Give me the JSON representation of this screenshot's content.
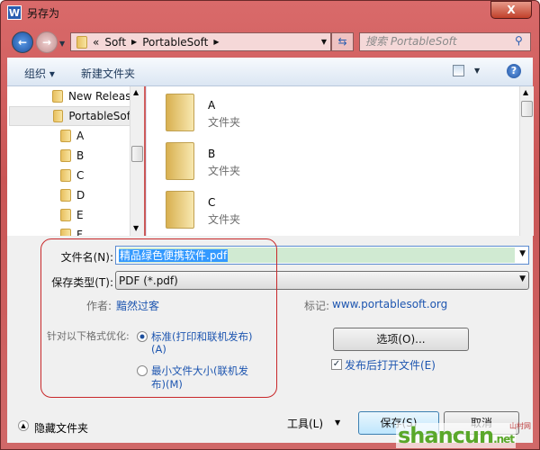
{
  "window": {
    "title": "另存为",
    "app_icon": "W",
    "close": "X"
  },
  "nav": {
    "back": "back-arrow-icon",
    "forward": "forward-arrow-icon",
    "breadcrumb": [
      "«",
      "Soft",
      "PortableSoft"
    ],
    "search_placeholder": "搜索 PortableSoft"
  },
  "toolbar": {
    "organize": "组织 ▾",
    "new_folder": "新建文件夹",
    "help": "?"
  },
  "tree": [
    "New Releas",
    "PortableSof",
    "A",
    "B",
    "C",
    "D",
    "E",
    "F"
  ],
  "files": [
    {
      "name": "A",
      "type": "文件夹"
    },
    {
      "name": "B",
      "type": "文件夹"
    },
    {
      "name": "C",
      "type": "文件夹"
    }
  ],
  "form": {
    "filename_label": "文件名(N):",
    "filename_value": "精品绿色便携软件.pdf",
    "type_label": "保存类型(T):",
    "type_value": "PDF (*.pdf)",
    "author_label": "作者:",
    "author_value": "黯然过客",
    "tags_label": "标记:",
    "tags_value": "www.portablesoft.org",
    "optimize_label": "针对以下格式优化:",
    "opt_standard": "标准(打印和联机发布)",
    "opt_standard_key": "(A)",
    "opt_min": "最小文件大小(联机发",
    "opt_min2": "布)(M)",
    "options_btn": "选项(O)...",
    "open_after": "发布后打开文件(E)",
    "open_after_checked": true,
    "selected_option": "standard"
  },
  "footer": {
    "hide_folders": "隐藏文件夹",
    "tools": "工具(L)",
    "save": "保存(S)",
    "cancel": "取消"
  },
  "watermark": {
    "text": "shancun",
    ".net": ".net",
    "sub": "山村网"
  },
  "colors": {
    "frame": "#d06060",
    "selection": "#3399ff",
    "filename_bg": "#d0ead2",
    "highlight_box": "#c8282a"
  }
}
